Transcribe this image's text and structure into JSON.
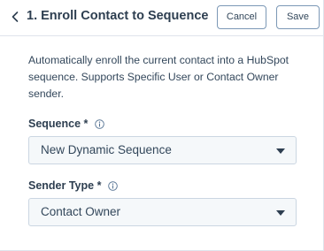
{
  "header": {
    "title": "1. Enroll Contact to Sequence",
    "back_icon": "chevron-left-icon",
    "cancel_label": "Cancel",
    "save_label": "Save"
  },
  "description": "Automatically enroll the current contact into a HubSpot sequence. Supports Specific User or Contact Owner sender.",
  "fields": {
    "sequence": {
      "label": "Sequence *",
      "info_icon": "info-icon",
      "value": "New Dynamic Sequence"
    },
    "sender_type": {
      "label": "Sender Type *",
      "info_icon": "info-icon",
      "value": "Contact Owner"
    }
  },
  "colors": {
    "text": "#33475b",
    "heading": "#2d3e50",
    "border": "#cbd6e2",
    "button_border": "#7c98b6",
    "select_bg": "#f5f8fa"
  }
}
